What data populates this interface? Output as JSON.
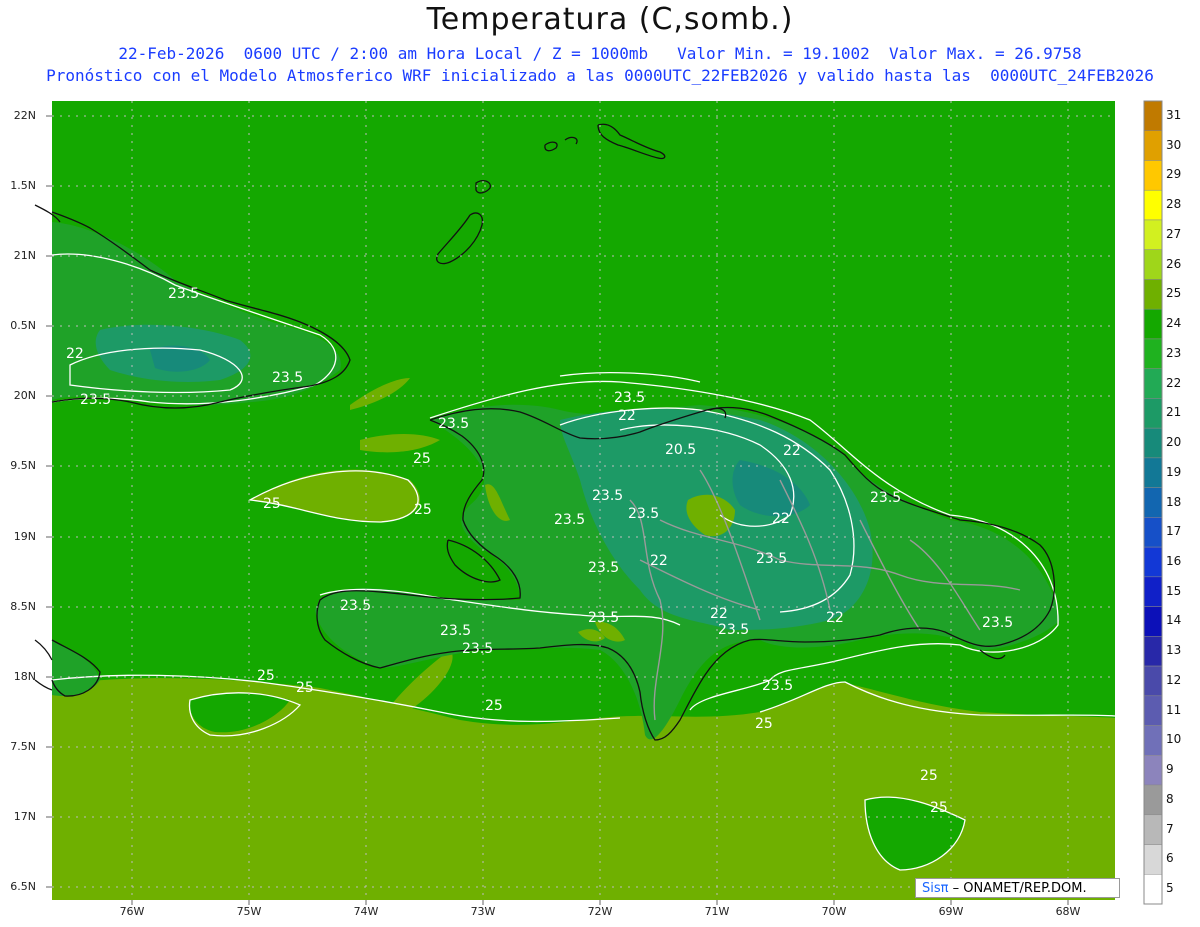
{
  "title": "Temperatura (C,somb.)",
  "subtitle_1": "22-Feb-2026  0600 UTC / 2:00 am Hora Local / Z = 1000mb   Valor Min. = 19.1002  Valor Max. = 26.9758",
  "subtitle_2": "Pronóstico con el Modelo Atmosferico WRF inicializado a las 0000UTC_22FEB2026 y valido hasta las  0000UTC_24FEB2026",
  "credit": {
    "logo": "Sisπ",
    "text": " – ONAMET/REP.DOM."
  },
  "lat_labels": [
    "22N",
    "1.5N",
    "21N",
    "0.5N",
    "20N",
    "9.5N",
    "19N",
    "8.5N",
    "18N",
    "7.5N",
    "17N",
    "6.5N"
  ],
  "lon_labels": [
    "76W",
    "75W",
    "74W",
    "73W",
    "72W",
    "71W",
    "70W",
    "69W",
    "68W"
  ],
  "colorbar": {
    "labels": [
      "31",
      "30",
      "29",
      "28",
      "27",
      "26",
      "25",
      "24",
      "23",
      "22",
      "21",
      "20",
      "19",
      "18",
      "17",
      "16",
      "15",
      "14",
      "13",
      "12",
      "11",
      "10",
      "9",
      "8",
      "7",
      "6",
      "5"
    ],
    "colors": [
      "#c07a00",
      "#e0a000",
      "#ffc800",
      "#ffff00",
      "#d2f020",
      "#9fd61a",
      "#6fb000",
      "#14a800",
      "#1fb21f",
      "#22aa55",
      "#1d9a66",
      "#178a7a",
      "#127896",
      "#1266b0",
      "#1650c8",
      "#1238d6",
      "#1020c8",
      "#0c10b8",
      "#2828a8",
      "#4a4aaa",
      "#5c5cb0",
      "#7070b8",
      "#8c84bc",
      "#9a9a9a",
      "#b8b8b8",
      "#d8d8d8",
      "#ffffff"
    ]
  },
  "contour_labels": [
    "23.5",
    "22",
    "23.5",
    "23.5",
    "23.5",
    "22",
    "20.5",
    "22",
    "23.5",
    "23.5",
    "23.5",
    "22",
    "23.5",
    "23.5",
    "23.5",
    "22",
    "23.5",
    "22",
    "23.5",
    "22",
    "23.5",
    "25",
    "25",
    "25",
    "25",
    "25",
    "25",
    "25",
    "25",
    "25",
    "25",
    "23.5",
    "23.5",
    "23.5",
    "23.5",
    "23.5",
    "22",
    "22"
  ],
  "colors": {
    "ocean_north": "#14a800",
    "ocean_south": "#6fb000",
    "land": "#1fa228",
    "land_cool": "#1d9a66",
    "land_cold": "#178a7a",
    "grid": "#bfbfbf"
  }
}
